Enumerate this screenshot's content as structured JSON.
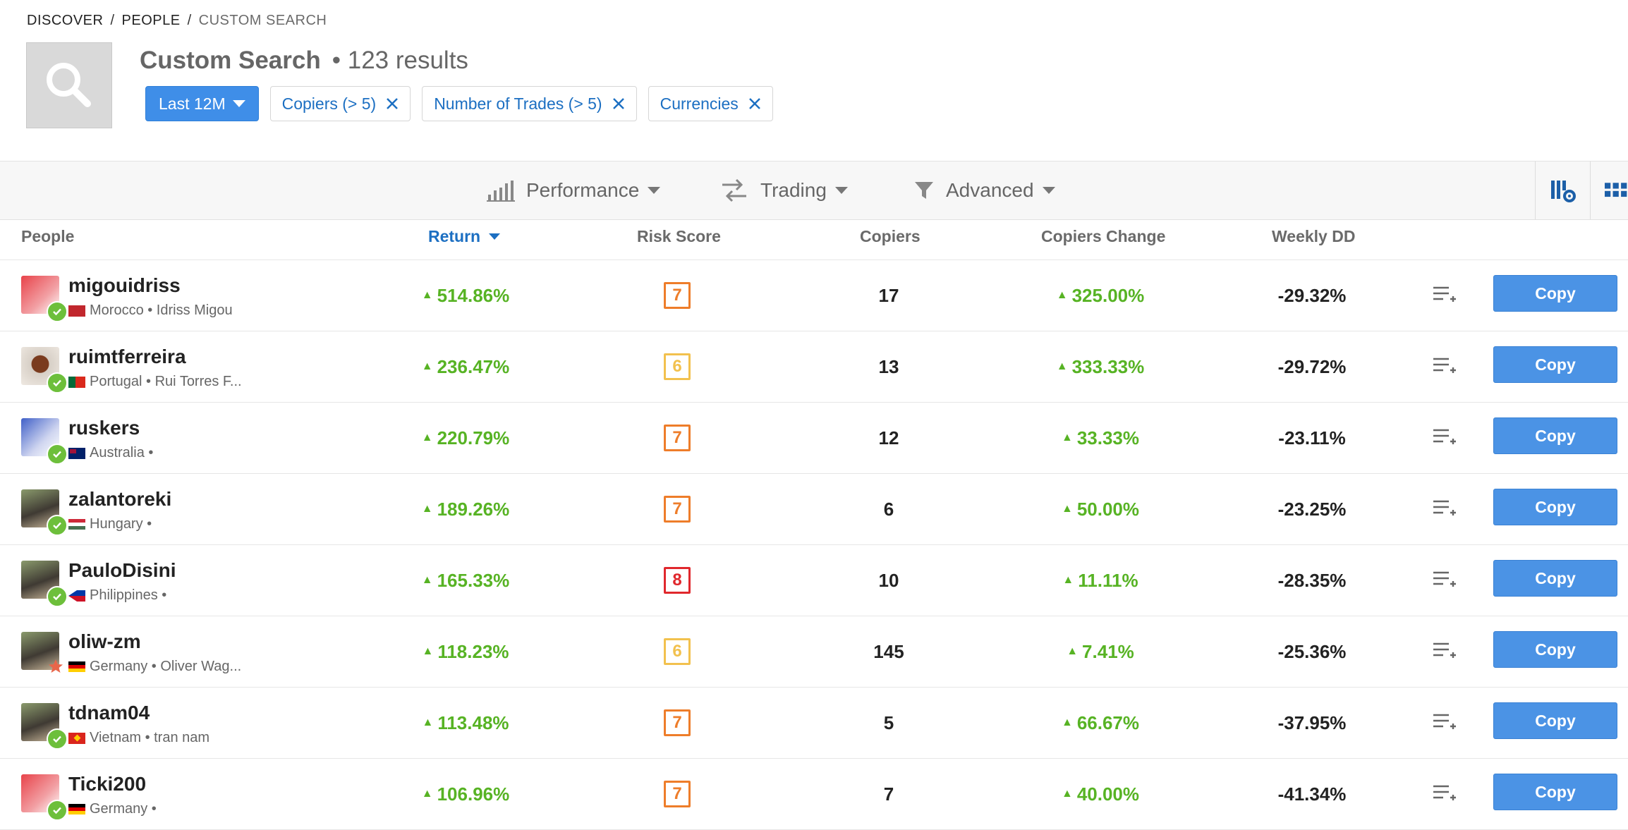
{
  "breadcrumb": [
    "DISCOVER",
    "PEOPLE",
    "CUSTOM SEARCH"
  ],
  "header": {
    "title": "Custom Search",
    "results": "• 123 results",
    "search_icon": "search-icon"
  },
  "filters": {
    "period": "Last 12M",
    "chips": [
      "Copiers (> 5)",
      "Number of Trades (> 5)",
      "Currencies"
    ]
  },
  "toolbar": {
    "performance": "Performance",
    "trading": "Trading",
    "advanced": "Advanced"
  },
  "columns": {
    "people": "People",
    "return": "Return",
    "risk": "Risk Score",
    "copiers": "Copiers",
    "copiers_change": "Copiers Change",
    "weekly_dd": "Weekly DD"
  },
  "colors": {
    "accent": "#1c6fc2",
    "button": "#4b93e5",
    "positive": "#57b324",
    "risk_orange": "#ee7d2a",
    "risk_yellow": "#f2c14e",
    "risk_red": "#e0282d"
  },
  "rows": [
    {
      "username": "migouidriss",
      "country": "Morocco",
      "subtitle": "Morocco • Idriss Migou",
      "flag": "MA",
      "return": "514.86%",
      "risk": "7",
      "copiers": "17",
      "change": "325.00%",
      "dd": "-29.32%",
      "copy": "Copy",
      "avatar": "red-bull-logo",
      "badge": "verified"
    },
    {
      "username": "ruimtferreira",
      "country": "Portugal",
      "subtitle": "Portugal • Rui Torres F...",
      "flag": "PT",
      "return": "236.47%",
      "risk": "6",
      "copiers": "13",
      "change": "333.33%",
      "dd": "-29.72%",
      "copy": "Copy",
      "avatar": "bull-photo",
      "badge": "verified"
    },
    {
      "username": "ruskers",
      "country": "Australia",
      "subtitle": "Australia •",
      "flag": "AU",
      "return": "220.79%",
      "risk": "7",
      "copiers": "12",
      "change": "33.33%",
      "dd": "-23.11%",
      "copy": "Copy",
      "avatar": "blue-bull-logo",
      "badge": "verified"
    },
    {
      "username": "zalantoreki",
      "country": "Hungary",
      "subtitle": "Hungary •",
      "flag": "HU",
      "return": "189.26%",
      "risk": "7",
      "copiers": "6",
      "change": "50.00%",
      "dd": "-23.25%",
      "copy": "Copy",
      "avatar": "person-photo",
      "badge": "verified"
    },
    {
      "username": "PauloDisini",
      "country": "Philippines",
      "subtitle": "Philippines •",
      "flag": "PH",
      "return": "165.33%",
      "risk": "8",
      "copiers": "10",
      "change": "11.11%",
      "dd": "-28.35%",
      "copy": "Copy",
      "avatar": "person-photo",
      "badge": "verified"
    },
    {
      "username": "oliw-zm",
      "country": "Germany",
      "subtitle": "Germany • Oliver Wag...",
      "flag": "DE",
      "return": "118.23%",
      "risk": "6",
      "copiers": "145",
      "change": "7.41%",
      "dd": "-25.36%",
      "copy": "Copy",
      "avatar": "person-photo",
      "badge": "star"
    },
    {
      "username": "tdnam04",
      "country": "Vietnam",
      "subtitle": "Vietnam • tran nam",
      "flag": "VN",
      "return": "113.48%",
      "risk": "7",
      "copiers": "5",
      "change": "66.67%",
      "dd": "-37.95%",
      "copy": "Copy",
      "avatar": "person-photo",
      "badge": "verified"
    },
    {
      "username": "Ticki200",
      "country": "Germany",
      "subtitle": "Germany •",
      "flag": "DE",
      "return": "106.96%",
      "risk": "7",
      "copiers": "7",
      "change": "40.00%",
      "dd": "-41.34%",
      "copy": "Copy",
      "avatar": "red-bull-logo",
      "badge": "verified"
    }
  ]
}
